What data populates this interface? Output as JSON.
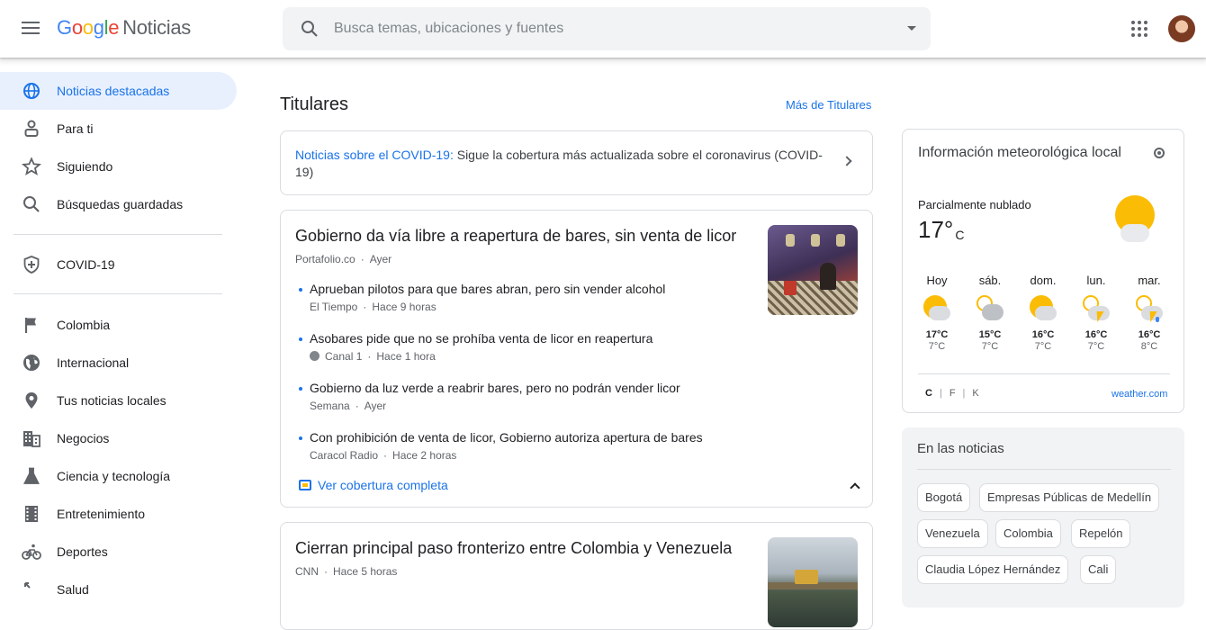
{
  "header": {
    "logo_parts": [
      "G",
      "o",
      "o",
      "g",
      "l",
      "e"
    ],
    "product": "Noticias",
    "search_placeholder": "Busca temas, ubicaciones y fuentes",
    "icons": {
      "menu": "menu-icon",
      "search": "search-icon",
      "apps": "apps-grid-icon",
      "avatar": "user-avatar"
    }
  },
  "sidebar": {
    "items": [
      {
        "label": "Noticias destacadas",
        "icon": "globe-icon",
        "active": true
      },
      {
        "label": "Para ti",
        "icon": "person-icon"
      },
      {
        "label": "Siguiendo",
        "icon": "star-icon"
      },
      {
        "label": "Búsquedas guardadas",
        "icon": "search-icon"
      },
      {
        "label": "COVID-19",
        "icon": "shield-plus-icon"
      },
      {
        "label": "Colombia",
        "icon": "flag-icon"
      },
      {
        "label": "Internacional",
        "icon": "world-icon"
      },
      {
        "label": "Tus noticias locales",
        "icon": "location-pin-icon"
      },
      {
        "label": "Negocios",
        "icon": "building-icon"
      },
      {
        "label": "Ciencia y tecnología",
        "icon": "flask-icon"
      },
      {
        "label": "Entretenimiento",
        "icon": "film-icon"
      },
      {
        "label": "Deportes",
        "icon": "bike-icon"
      },
      {
        "label": "Salud",
        "icon": "health-icon"
      }
    ]
  },
  "main": {
    "section_title": "Titulares",
    "more_link": "Más de Titulares",
    "covid_banner": {
      "lead": "Noticias sobre el COVID-19:",
      "text": " Sigue la cobertura más actualizada sobre el coronavirus (COVID-19)"
    },
    "stories": [
      {
        "title": "Gobierno da vía libre a reapertura de bares, sin venta de licor",
        "source": "Portafolio.co",
        "time": "Ayer",
        "related": [
          {
            "title": "Aprueban pilotos para que bares abran, pero sin vender alcohol",
            "source": "El Tiempo",
            "time": "Hace 9 horas"
          },
          {
            "title": "Asobares pide que no se prohíba venta de licor en reapertura",
            "source": "Canal 1",
            "time": "Hace 1 hora"
          },
          {
            "title": "Gobierno da luz verde a reabrir bares, pero no podrán vender licor",
            "source": "Semana",
            "time": "Ayer"
          },
          {
            "title": "Con prohibición de venta de licor, Gobierno autoriza apertura de bares",
            "source": "Caracol Radio",
            "time": "Hace 2 horas"
          }
        ],
        "coverage_label": "Ver cobertura completa"
      },
      {
        "title": "Cierran principal paso fronterizo entre Colombia y Venezuela",
        "source": "CNN",
        "time": "Hace 5 horas"
      }
    ]
  },
  "weather": {
    "title": "Información meteorológica local",
    "condition": "Parcialmente nublado",
    "temp": "17°",
    "unit": "C",
    "forecast": [
      {
        "day": "Hoy",
        "hi": "17°C",
        "lo": "7°C",
        "icon": "partly-cloudy-icon"
      },
      {
        "day": "sáb.",
        "hi": "15°C",
        "lo": "7°C",
        "icon": "cloudy-icon"
      },
      {
        "day": "dom.",
        "hi": "16°C",
        "lo": "7°C",
        "icon": "partly-cloudy-icon"
      },
      {
        "day": "lun.",
        "hi": "16°C",
        "lo": "7°C",
        "icon": "thunderstorm-icon"
      },
      {
        "day": "mar.",
        "hi": "16°C",
        "lo": "8°C",
        "icon": "thunderstorm-rain-icon"
      }
    ],
    "units": [
      "C",
      "F",
      "K"
    ],
    "selected_unit": "C",
    "source": "weather.com"
  },
  "in_the_news": {
    "title": "En las noticias",
    "chips": [
      "Bogotá",
      "Empresas Públicas de Medellín",
      "Venezuela",
      "Colombia",
      "Repelón",
      "Claudia López Hernández",
      "Cali"
    ]
  },
  "colors": {
    "accent": "#1a73e8",
    "active_bg": "#e8f0fe",
    "sun": "#fbbc05"
  }
}
